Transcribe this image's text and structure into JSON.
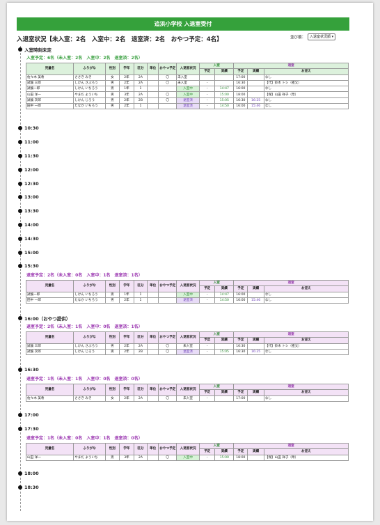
{
  "banner": "追浜小学校 入退室受付",
  "status_title": "入退室状況【未入室：2名　入室中：2名　退室済：2名　おやつ予定：4名】",
  "sort": {
    "label": "並び順：",
    "value": "入退室状況順"
  },
  "headers": {
    "name": "児童名",
    "kana": "ふりがな",
    "sex": "性別",
    "grade": "学年",
    "div": "区分",
    "unit": "単位",
    "snack": "おやつ予定",
    "status": "入退室状況",
    "in": "入室",
    "out": "退室",
    "plan": "予定",
    "actual": "実績",
    "pickup": "お迎え"
  },
  "slots": [
    {
      "time": "入室時刻未定",
      "groups": [
        {
          "kind": "in",
          "summary": "入室予定：6名（未入室：2名　入室中：2名　退室済：2名）",
          "rows": [
            {
              "name": "佐々木 美希",
              "kana": "ささき みき",
              "sex": "女",
              "grade": "2年",
              "div": "2A",
              "unit": "",
              "snack": "〇",
              "status": "未入室",
              "st": "none",
              "in_plan": "",
              "in_act": "",
              "out_plan": "17:00",
              "out_act": "",
              "pickup": "なし"
            },
            {
              "name": "試験 三郎",
              "kana": "しけん さぶろう",
              "sex": "男",
              "grade": "2年",
              "div": "2A",
              "unit": "",
              "snack": "〇",
              "status": "未入室",
              "st": "none",
              "in_plan": "-",
              "in_act": "",
              "out_plan": "16:30",
              "out_act": "",
              "pickup": "【代】鈴木 トシ（祖父）"
            },
            {
              "name": "試験一郎",
              "kana": "しけん いちろう",
              "sex": "男",
              "grade": "1年",
              "div": "1",
              "unit": "",
              "snack": "",
              "status": "入室中",
              "st": "in",
              "in_plan": "-",
              "in_act": "14:47",
              "out_plan": "16:00",
              "out_act": "",
              "pickup": "なし"
            },
            {
              "name": "山田 洋一",
              "kana": "やまだ よういち",
              "sex": "男",
              "grade": "3年",
              "div": "2A",
              "unit": "",
              "snack": "〇",
              "status": "入室中",
              "st": "in",
              "in_plan": "-",
              "in_act": "15:00",
              "out_plan": "18:00",
              "out_act": "",
              "pickup": "【保】山田 祥子（母）"
            },
            {
              "name": "試験 次郎",
              "kana": "しけん じろう",
              "sex": "男",
              "grade": "2年",
              "div": "2B",
              "unit": "",
              "snack": "〇",
              "status": "退室済",
              "st": "out",
              "in_plan": "-",
              "in_act": "15:05",
              "out_plan": "16:30",
              "out_act": "16:25",
              "pickup": "なし"
            },
            {
              "name": "田中 一郎",
              "kana": "たなか いちろう",
              "sex": "男",
              "grade": "2年",
              "div": "1",
              "unit": "",
              "snack": "",
              "status": "退室済",
              "st": "out",
              "in_plan": "-",
              "in_act": "14:50",
              "out_plan": "16:00",
              "out_act": "15:46",
              "pickup": "なし"
            }
          ]
        }
      ]
    },
    {
      "time": "10:30",
      "groups": []
    },
    {
      "time": "11:00",
      "groups": []
    },
    {
      "time": "11:30",
      "groups": []
    },
    {
      "time": "12:00",
      "groups": []
    },
    {
      "time": "12:30",
      "groups": []
    },
    {
      "time": "13:00",
      "groups": []
    },
    {
      "time": "13:30",
      "groups": []
    },
    {
      "time": "14:00",
      "groups": []
    },
    {
      "time": "14:30",
      "groups": []
    },
    {
      "time": "15:00",
      "groups": []
    },
    {
      "time": "15:30",
      "groups": [
        {
          "kind": "out",
          "summary": "退室予定：2名（未入室：0名　入室中：1名　退室済：1名）",
          "rows": [
            {
              "name": "試験一郎",
              "kana": "しけん いちろう",
              "sex": "男",
              "grade": "1年",
              "div": "1",
              "unit": "",
              "snack": "",
              "status": "入室中",
              "st": "in",
              "in_plan": "-",
              "in_act": "14:47",
              "out_plan": "16:00",
              "out_act": "",
              "pickup": "なし"
            },
            {
              "name": "田中 一郎",
              "kana": "たなか いちろう",
              "sex": "男",
              "grade": "2年",
              "div": "1",
              "unit": "",
              "snack": "",
              "status": "退室済",
              "st": "out",
              "in_plan": "-",
              "in_act": "14:50",
              "out_plan": "16:00",
              "out_act": "15:46",
              "pickup": "なし"
            }
          ]
        }
      ]
    },
    {
      "time": "16:00（おやつ提供）",
      "groups": [
        {
          "kind": "out",
          "summary": "退室予定：2名（未入室：1名　入室中：0名　退室済：1名）",
          "rows": [
            {
              "name": "試験 三郎",
              "kana": "しけん さぶろう",
              "sex": "男",
              "grade": "2年",
              "div": "2A",
              "unit": "",
              "snack": "〇",
              "status": "未入室",
              "st": "plain",
              "in_plan": "-",
              "in_act": "",
              "out_plan": "16:30",
              "out_act": "",
              "pickup": "【代】鈴木 トシ（祖父）"
            },
            {
              "name": "試験 次郎",
              "kana": "しけん じろう",
              "sex": "男",
              "grade": "2年",
              "div": "2B",
              "unit": "",
              "snack": "〇",
              "status": "退室済",
              "st": "out",
              "in_plan": "-",
              "in_act": "15:05",
              "out_plan": "16:30",
              "out_act": "16:25",
              "pickup": "なし"
            }
          ]
        }
      ]
    },
    {
      "time": "16:30",
      "groups": [
        {
          "kind": "out",
          "summary": "退室予定：1名（未入室：1名　入室中：0名　退室済：0名）",
          "rows": [
            {
              "name": "佐々木 美希",
              "kana": "ささき みき",
              "sex": "女",
              "grade": "2年",
              "div": "2A",
              "unit": "",
              "snack": "〇",
              "status": "未入室",
              "st": "plain",
              "in_plan": "-",
              "in_act": "",
              "out_plan": "17:00",
              "out_act": "",
              "pickup": "なし"
            }
          ]
        }
      ]
    },
    {
      "time": "17:00",
      "groups": []
    },
    {
      "time": "17:30",
      "groups": [
        {
          "kind": "out",
          "summary": "退室予定：1名（未入室：0名　入室中：1名　退室済：0名）",
          "rows": [
            {
              "name": "山田 洋一",
              "kana": "やまだ よういち",
              "sex": "男",
              "grade": "3年",
              "div": "2A",
              "unit": "",
              "snack": "〇",
              "status": "入室中",
              "st": "in",
              "in_plan": "-",
              "in_act": "15:00",
              "out_plan": "18:00",
              "out_act": "",
              "pickup": "【保】山田 祥子（母）"
            }
          ]
        }
      ]
    },
    {
      "time": "18:00",
      "groups": []
    },
    {
      "time": "18:30",
      "groups": []
    }
  ]
}
